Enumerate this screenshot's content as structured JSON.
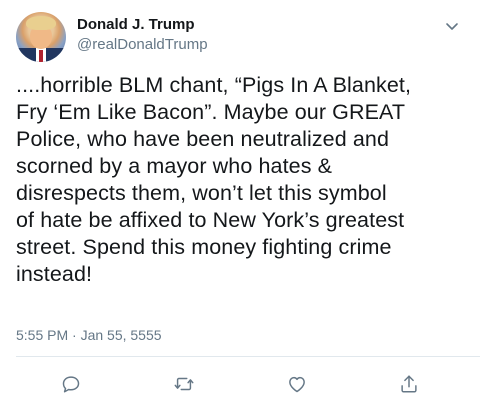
{
  "user": {
    "display_name": "Donald J. Trump",
    "handle": "@realDonaldTrump"
  },
  "tweet": {
    "text": "....horrible BLM chant, “Pigs In A Blanket,\nFry ‘Em Like Bacon”. Maybe our GREAT\nPolice, who have been neutralized and\nscorned by a mayor who hates &\ndisrespects them, won’t let this symbol\nof hate be affixed to New York’s greatest\nstreet. Spend this money fighting crime\ninstead!",
    "timestamp": "5:55 PM · Jan 55, 5555"
  },
  "icons": {
    "menu": "chevron-down-icon",
    "reply": "reply-icon",
    "retweet": "retweet-icon",
    "like": "heart-icon",
    "share": "share-icon"
  },
  "colors": {
    "text": "#14171a",
    "secondary": "#657786",
    "divider": "#e1e8ed",
    "icon": "#657786"
  }
}
